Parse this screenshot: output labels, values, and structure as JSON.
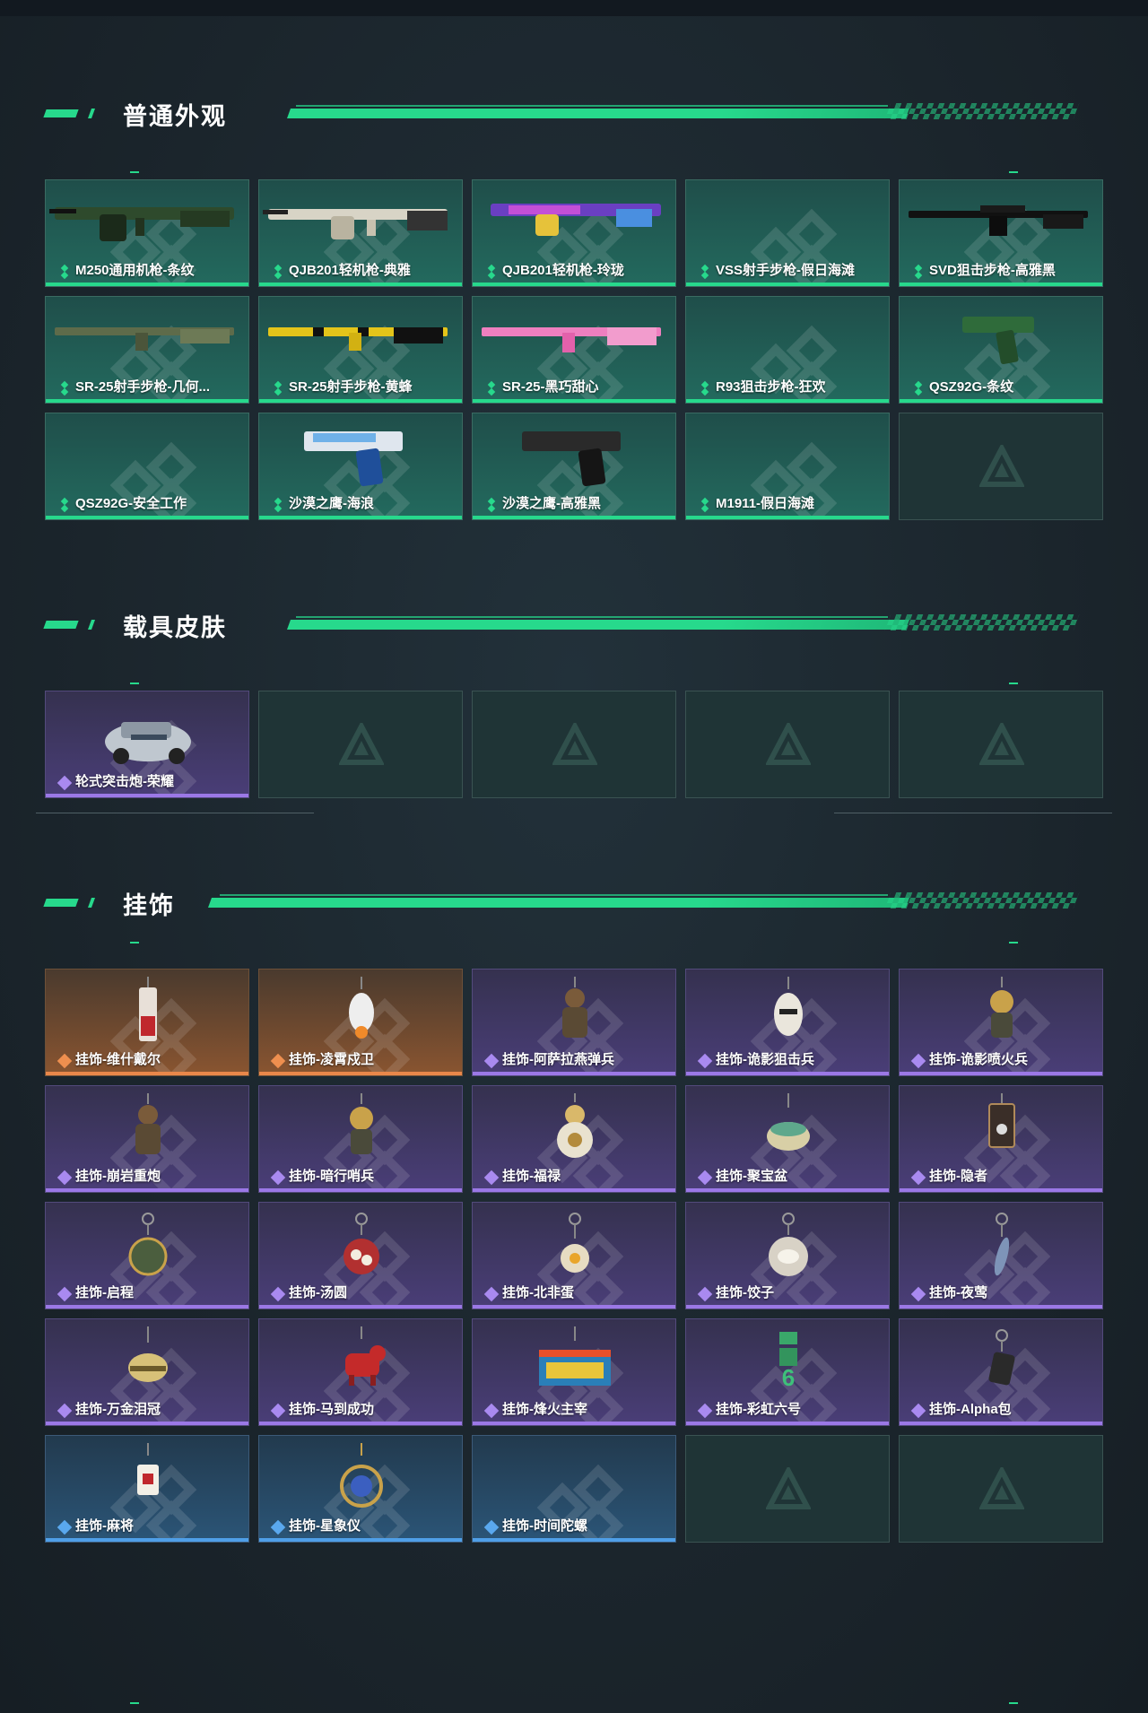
{
  "sections": {
    "weapon": {
      "title": "普通外观",
      "items": [
        {
          "label": "M250通用机枪-条纹",
          "rarity": "green",
          "art": "lmg-camo"
        },
        {
          "label": "QJB201轻机枪-典雅",
          "rarity": "green",
          "art": "lmg-white"
        },
        {
          "label": "QJB201轻机枪-玲珑",
          "rarity": "green",
          "art": "lmg-purple"
        },
        {
          "label": "VSS射手步枪-假日海滩",
          "rarity": "green",
          "art": "none"
        },
        {
          "label": "SVD狙击步枪-高雅黑",
          "rarity": "green",
          "art": "sniper-black"
        },
        {
          "label": "SR-25射手步枪-几何...",
          "rarity": "green",
          "art": "rifle-camo"
        },
        {
          "label": "SR-25射手步枪-黄蜂",
          "rarity": "green",
          "art": "rifle-yellow"
        },
        {
          "label": "SR-25-黑巧甜心",
          "rarity": "green",
          "art": "rifle-pink"
        },
        {
          "label": "R93狙击步枪-狂欢",
          "rarity": "green",
          "art": "none"
        },
        {
          "label": "QSZ92G-条纹",
          "rarity": "green",
          "art": "pistol-green"
        },
        {
          "label": "QSZ92G-安全工作",
          "rarity": "green",
          "art": "none"
        },
        {
          "label": "沙漠之鹰-海浪",
          "rarity": "green",
          "art": "deagle-blue"
        },
        {
          "label": "沙漠之鹰-高雅黑",
          "rarity": "green",
          "art": "deagle-black"
        },
        {
          "label": "M1911-假日海滩",
          "rarity": "green",
          "art": "none"
        },
        {
          "label": "",
          "rarity": "empty",
          "art": "none"
        }
      ]
    },
    "vehicle": {
      "title": "载具皮肤",
      "items": [
        {
          "label": "轮式突击炮-荣耀",
          "rarity": "purple",
          "art": "vehicle"
        },
        {
          "label": "",
          "rarity": "empty",
          "art": "none"
        },
        {
          "label": "",
          "rarity": "empty",
          "art": "none"
        },
        {
          "label": "",
          "rarity": "empty",
          "art": "none"
        },
        {
          "label": "",
          "rarity": "empty",
          "art": "none"
        }
      ]
    },
    "charm": {
      "title": "挂饰",
      "items": [
        {
          "label": "挂饰-维什戴尔",
          "rarity": "orange",
          "art": "charm-red"
        },
        {
          "label": "挂饰-凌霄戍卫",
          "rarity": "orange",
          "art": "charm-white"
        },
        {
          "label": "挂饰-阿萨拉燕弹兵",
          "rarity": "purple",
          "art": "charm-soldier"
        },
        {
          "label": "挂饰-诡影狙击兵",
          "rarity": "purple",
          "art": "charm-ghost"
        },
        {
          "label": "挂饰-诡影喷火兵",
          "rarity": "purple",
          "art": "charm-gold"
        },
        {
          "label": "挂饰-崩岩重炮",
          "rarity": "purple",
          "art": "charm-soldier"
        },
        {
          "label": "挂饰-暗行哨兵",
          "rarity": "purple",
          "art": "charm-gold"
        },
        {
          "label": "挂饰-福禄",
          "rarity": "purple",
          "art": "charm-gourd"
        },
        {
          "label": "挂饰-聚宝盆",
          "rarity": "purple",
          "art": "charm-bowl"
        },
        {
          "label": "挂饰-隐者",
          "rarity": "purple",
          "art": "charm-card"
        },
        {
          "label": "挂饰-启程",
          "rarity": "purple",
          "art": "charm-ring"
        },
        {
          "label": "挂饰-汤圆",
          "rarity": "purple",
          "art": "charm-round-red"
        },
        {
          "label": "挂饰-北非蛋",
          "rarity": "purple",
          "art": "charm-egg"
        },
        {
          "label": "挂饰-饺子",
          "rarity": "purple",
          "art": "charm-dumpling"
        },
        {
          "label": "挂饰-夜莺",
          "rarity": "purple",
          "art": "charm-feather"
        },
        {
          "label": "挂饰-万金泪冠",
          "rarity": "purple",
          "art": "charm-crown"
        },
        {
          "label": "挂饰-马到成功",
          "rarity": "purple",
          "art": "charm-horse"
        },
        {
          "label": "挂饰-烽火主宰",
          "rarity": "purple",
          "art": "charm-banner"
        },
        {
          "label": "挂饰-彩虹六号",
          "rarity": "purple",
          "art": "charm-six"
        },
        {
          "label": "挂饰-Alpha包",
          "rarity": "purple",
          "art": "charm-bag"
        },
        {
          "label": "挂饰-麻将",
          "rarity": "blue",
          "art": "charm-mahjong"
        },
        {
          "label": "挂饰-星象仪",
          "rarity": "blue",
          "art": "charm-orb"
        },
        {
          "label": "挂饰-时间陀螺",
          "rarity": "blue",
          "art": "none"
        },
        {
          "label": "",
          "rarity": "empty",
          "art": "none"
        },
        {
          "label": "",
          "rarity": "empty",
          "art": "none"
        }
      ]
    }
  },
  "colors": {
    "accent": "#27d98c",
    "green": "#27d98c",
    "purple": "#9b78e6",
    "orange": "#e9874a",
    "blue": "#4f9fe8"
  }
}
